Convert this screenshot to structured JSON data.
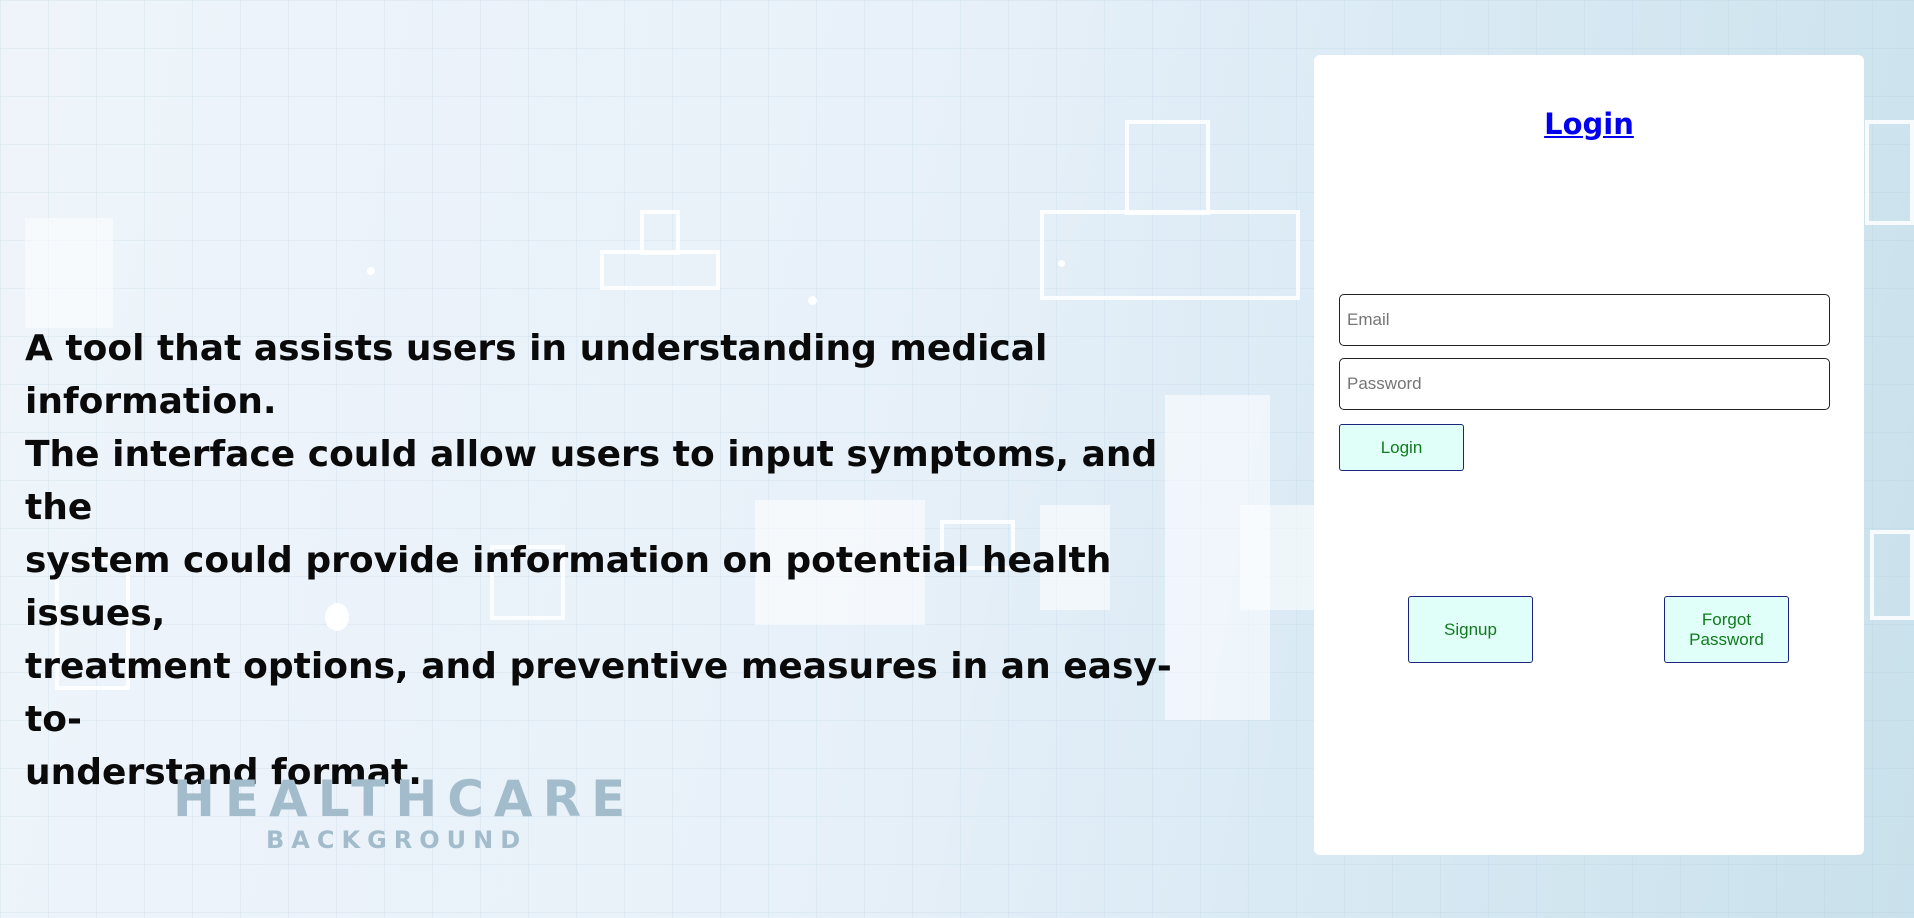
{
  "hero": {
    "text": "A tool that assists users in understanding medical information. The interface could allow users to input symptoms, and the system could provide information on potential health issues, treatment options, and preventive measures in an easy-to-understand format.",
    "lines": [
      "A tool that assists users in understanding medical information.",
      "The interface could allow users to input symptoms, and the",
      "system could provide information on potential health issues,",
      "treatment options, and preventive measures in an easy-to-",
      "understand format."
    ]
  },
  "watermark": {
    "title": "HEALTHCARE",
    "subtitle": "BACKGROUND"
  },
  "login": {
    "title": "Login",
    "email_placeholder": "Email",
    "password_placeholder": "Password",
    "login_label": "Login",
    "signup_label": "Signup",
    "forgot_label": "Forgot Password"
  },
  "colors": {
    "link": "#0000ee",
    "button_bg": "#e0fff8",
    "button_text": "#117a1e",
    "button_border": "#1a237e"
  }
}
